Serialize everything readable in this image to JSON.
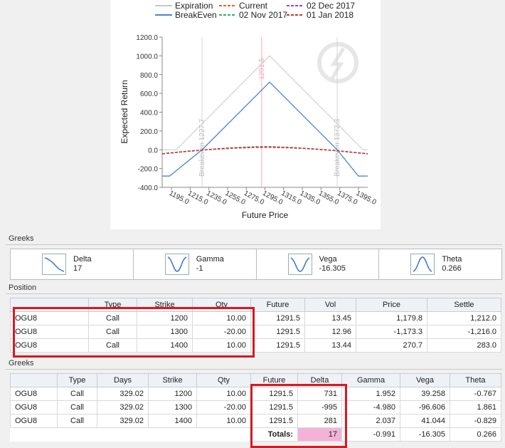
{
  "chart_data": {
    "type": "line",
    "xlabel": "Future Price",
    "ylabel": "Expected Return",
    "xlim": [
      1185,
      1405
    ],
    "ylim": [
      -400,
      1200
    ],
    "x_ticks": [
      "1195.0",
      "1215.0",
      "1235.0",
      "1255.0",
      "1275.0",
      "1295.0",
      "1315.0",
      "1335.0",
      "1355.0",
      "1375.0",
      "1395.0"
    ],
    "y_ticks": [
      "1200.0",
      "1000.0",
      "800.0",
      "600.0",
      "400.0",
      "200.0",
      "0.0",
      "-200.0",
      "-400.0"
    ],
    "legend": {
      "placement": "top",
      "entries": [
        {
          "name": "Expiration",
          "color": "#c8c8c8",
          "dash": false
        },
        {
          "name": "Current",
          "color": "#e8632c",
          "dash": true
        },
        {
          "name": "02 Dec 2017",
          "color": "#9b3fd1",
          "dash": true
        },
        {
          "name": "BreakEven",
          "color": "#4a86c8",
          "dash": false
        },
        {
          "name": "02 Nov 2017",
          "color": "#3aaa6a",
          "dash": true
        },
        {
          "name": "01 Jan 2018",
          "color": "#c0392b",
          "dash": true
        }
      ]
    },
    "vlines": [
      {
        "x": 1227.7,
        "label": "Breakeven 1227.7",
        "color": "#d5d5d5"
      },
      {
        "x": 1291.5,
        "label": "1291.5",
        "color": "#f4a8b8"
      },
      {
        "x": 1372.3,
        "label": "Breakeven 1372.3",
        "color": "#d5d5d5"
      }
    ],
    "series": [
      {
        "name": "Expiration",
        "x": [
          1185,
          1200,
          1300,
          1400,
          1405
        ],
        "values": [
          0,
          0,
          1000,
          0,
          0
        ]
      },
      {
        "name": "BreakEven",
        "x": [
          1185,
          1193,
          1227.7,
          1300,
          1372.3,
          1395,
          1405
        ],
        "values": [
          -280,
          -280,
          0,
          720,
          0,
          -280,
          -280
        ]
      },
      {
        "name": "Current",
        "x": [
          1185,
          1210,
          1235,
          1260,
          1285,
          1300,
          1320,
          1345,
          1370,
          1395,
          1405
        ],
        "values": [
          -45,
          -20,
          0,
          15,
          23,
          24,
          20,
          8,
          -10,
          -35,
          -45
        ]
      },
      {
        "name": "02 Nov 2017",
        "x": [
          1185,
          1210,
          1235,
          1260,
          1285,
          1300,
          1320,
          1345,
          1370,
          1395,
          1405
        ],
        "values": [
          -44,
          -19,
          2,
          17,
          26,
          27,
          22,
          9,
          -9,
          -34,
          -44
        ]
      },
      {
        "name": "02 Dec 2017",
        "x": [
          1185,
          1210,
          1235,
          1260,
          1285,
          1300,
          1320,
          1345,
          1370,
          1395,
          1405
        ],
        "values": [
          -43,
          -18,
          3,
          19,
          29,
          30,
          24,
          10,
          -8,
          -33,
          -43
        ]
      },
      {
        "name": "01 Jan 2018",
        "x": [
          1185,
          1210,
          1235,
          1260,
          1285,
          1300,
          1320,
          1345,
          1370,
          1395,
          1405
        ],
        "values": [
          -42,
          -17,
          4,
          21,
          32,
          33,
          26,
          11,
          -7,
          -32,
          -42
        ]
      }
    ]
  },
  "greeks_label": "Greeks",
  "position_label": "Position",
  "greeks_label_2": "Greeks",
  "greeks_summary": [
    {
      "name": "Delta",
      "value": "17",
      "icon": "delta-curve-icon"
    },
    {
      "name": "Gamma",
      "value": "-1",
      "icon": "gamma-curve-icon"
    },
    {
      "name": "Vega",
      "value": "-16.305",
      "icon": "vega-curve-icon"
    },
    {
      "name": "Theta",
      "value": "0.266",
      "icon": "theta-curve-icon"
    }
  ],
  "position_table": {
    "headers": [
      "",
      "Type",
      "Strike",
      "Qty",
      "Future",
      "Vol",
      "Price",
      "Settle"
    ],
    "rows": [
      [
        "OGU8",
        "Call",
        "1200",
        "10.00",
        "1291.5",
        "13.45",
        "1,179.8",
        "1,212.0"
      ],
      [
        "OGU8",
        "Call",
        "1300",
        "-20.00",
        "1291.5",
        "12.96",
        "-1,173.3",
        "-1,216.0"
      ],
      [
        "OGU8",
        "Call",
        "1400",
        "10.00",
        "1291.5",
        "13.44",
        "270.7",
        "283.0"
      ]
    ]
  },
  "greeks_table": {
    "headers": [
      "",
      "Type",
      "Days",
      "Strike",
      "Qty",
      "Future",
      "Delta",
      "Gamma",
      "Vega",
      "Theta"
    ],
    "rows": [
      [
        "OGU8",
        "Call",
        "329.02",
        "1200",
        "10.00",
        "1291.5",
        "731",
        "1.952",
        "39.258",
        "-0.767"
      ],
      [
        "OGU8",
        "Call",
        "329.02",
        "1300",
        "-20.00",
        "1291.5",
        "-995",
        "-4.980",
        "-96.606",
        "1.861"
      ],
      [
        "OGU8",
        "Call",
        "329.02",
        "1400",
        "10.00",
        "1291.5",
        "281",
        "2.037",
        "41.044",
        "-0.829"
      ]
    ],
    "totals_label": "Totals:",
    "totals": {
      "delta": "17",
      "gamma": "-0.991",
      "vega": "-16.305",
      "theta": "0.266"
    }
  }
}
